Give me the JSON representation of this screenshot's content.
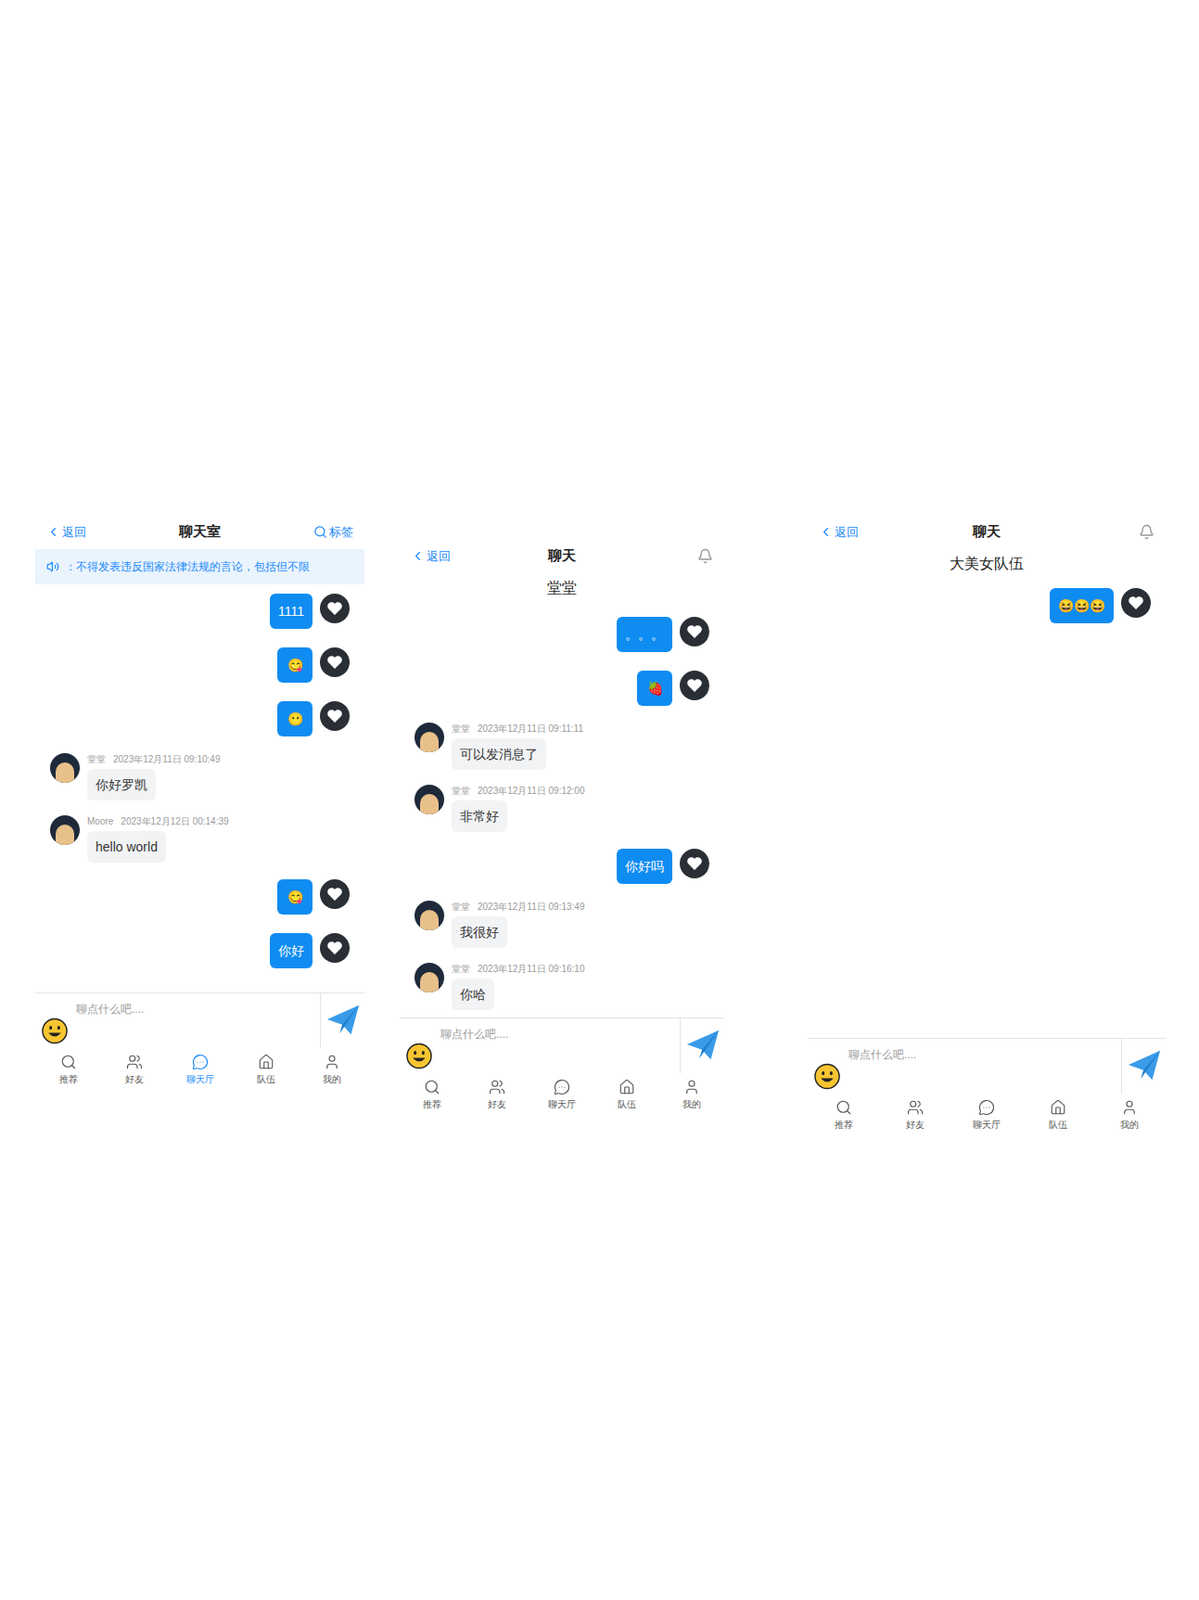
{
  "panels": [
    {
      "header": {
        "back": "返回",
        "title": "聊天室",
        "action": "标签"
      },
      "subtitle": "",
      "notice": "：不得发表违反国家法律法规的言论，包括但不限",
      "messages": [
        {
          "kind": "mine",
          "sender": "",
          "time": "",
          "text": "1111"
        },
        {
          "kind": "mine",
          "sender": "",
          "time": "",
          "text": "😋"
        },
        {
          "kind": "mine",
          "sender": "",
          "time": "",
          "text": "😶"
        },
        {
          "kind": "other",
          "sender": "堂堂",
          "time": "2023年12月11日 09:10:49",
          "text": "你好罗凯"
        },
        {
          "kind": "other",
          "sender": "Moore",
          "time": "2023年12月12日 00:14:39",
          "text": "hello world"
        },
        {
          "kind": "mine",
          "sender": "",
          "time": "",
          "text": "😋"
        },
        {
          "kind": "mine",
          "sender": "",
          "time": "",
          "text": "你好"
        }
      ],
      "input": {
        "placeholder": "聊点什么吧...."
      },
      "nav": [
        {
          "label": "推荐",
          "selected": false
        },
        {
          "label": "好友",
          "selected": false
        },
        {
          "label": "聊天厅",
          "selected": true
        },
        {
          "label": "队伍",
          "selected": false
        },
        {
          "label": "我的",
          "selected": false
        }
      ]
    },
    {
      "header": {
        "back": "返回",
        "title": "聊天",
        "action": ""
      },
      "subtitle": "堂堂",
      "notice": "",
      "messages": [
        {
          "kind": "mine",
          "sender": "",
          "time": "",
          "text": "。。。"
        },
        {
          "kind": "mine",
          "sender": "",
          "time": "",
          "text": "🍓"
        },
        {
          "kind": "other",
          "sender": "堂堂",
          "time": "2023年12月11日 09:11:11",
          "text": "可以发消息了"
        },
        {
          "kind": "other",
          "sender": "堂堂",
          "time": "2023年12月11日 09:12:00",
          "text": "非常好"
        },
        {
          "kind": "mine",
          "sender": "",
          "time": "",
          "text": "你好吗"
        },
        {
          "kind": "other",
          "sender": "堂堂",
          "time": "2023年12月11日 09:13:49",
          "text": "我很好"
        },
        {
          "kind": "other",
          "sender": "堂堂",
          "time": "2023年12月11日 09:16:10",
          "text": "你哈"
        }
      ],
      "input": {
        "placeholder": "聊点什么吧...."
      },
      "nav": [
        {
          "label": "推荐",
          "selected": false
        },
        {
          "label": "好友",
          "selected": false
        },
        {
          "label": "聊天厅",
          "selected": false
        },
        {
          "label": "队伍",
          "selected": false
        },
        {
          "label": "我的",
          "selected": false
        }
      ]
    },
    {
      "header": {
        "back": "返回",
        "title": "聊天",
        "action": ""
      },
      "subtitle": "大美女队伍",
      "notice": "",
      "messages": [
        {
          "kind": "mine",
          "sender": "",
          "time": "",
          "text": "😆😆😆"
        }
      ],
      "input": {
        "placeholder": "聊点什么吧...."
      },
      "nav": [
        {
          "label": "推荐",
          "selected": false
        },
        {
          "label": "好友",
          "selected": false
        },
        {
          "label": "聊天厅",
          "selected": false
        },
        {
          "label": "队伍",
          "selected": false
        },
        {
          "label": "我的",
          "selected": false
        }
      ]
    }
  ]
}
